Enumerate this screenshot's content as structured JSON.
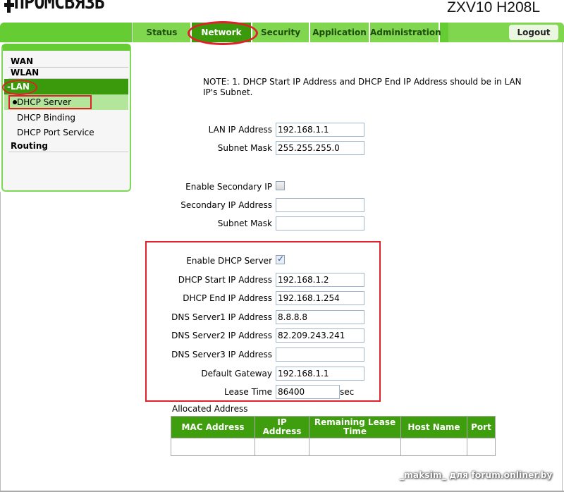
{
  "header": {
    "logo_text": "ПРОМСВЯЗЬ",
    "model": "ZXV10 H208L"
  },
  "nav": {
    "tabs": [
      {
        "label": "Status",
        "active": false
      },
      {
        "label": "Network",
        "active": true
      },
      {
        "label": "Security",
        "active": false
      },
      {
        "label": "Application",
        "active": false
      },
      {
        "label": "Administration",
        "active": false
      }
    ],
    "logout_label": "Logout"
  },
  "sidebar": {
    "items": [
      {
        "label": "WAN"
      },
      {
        "label": "WLAN"
      },
      {
        "label": "-LAN",
        "expanded": true
      },
      {
        "label": "DHCP Server",
        "selected": true
      },
      {
        "label": "DHCP Binding"
      },
      {
        "label": "DHCP Port Service"
      },
      {
        "label": "Routing"
      }
    ]
  },
  "main": {
    "note": "NOTE:  1. DHCP Start IP Address and DHCP End IP Address should be in LAN IP's Subnet.",
    "lan": {
      "lan_ip_label": "LAN IP Address",
      "lan_ip_value": "192.168.1.1",
      "subnet_label": "Subnet Mask",
      "subnet_value": "255.255.255.0"
    },
    "secondary": {
      "enable_label": "Enable Secondary IP",
      "enable_checked": false,
      "ip_label": "Secondary IP Address",
      "ip_value": "",
      "subnet_label": "Subnet Mask",
      "subnet_value": ""
    },
    "dhcp": {
      "enable_label": "Enable DHCP Server",
      "enable_checked": true,
      "start_label": "DHCP Start IP Address",
      "start_value": "192.168.1.2",
      "end_label": "DHCP End IP Address",
      "end_value": "192.168.1.254",
      "dns1_label": "DNS Server1 IP Address",
      "dns1_value": "8.8.8.8",
      "dns2_label": "DNS Server2 IP Address",
      "dns2_value": "82.209.243.241",
      "dns3_label": "DNS Server3 IP Address",
      "dns3_value": "",
      "gateway_label": "Default Gateway",
      "gateway_value": "192.168.1.1",
      "lease_label": "Lease Time",
      "lease_value": "86400",
      "lease_unit": "sec"
    },
    "allocated": {
      "title": "Allocated Address",
      "columns": [
        "MAC Address",
        "IP Address",
        "Remaining Lease Time",
        "Host Name",
        "Port"
      ],
      "rows": [
        [
          "",
          "",
          "",
          "",
          ""
        ]
      ]
    }
  },
  "watermark": "_maksim_ для forum.onliner.by"
}
